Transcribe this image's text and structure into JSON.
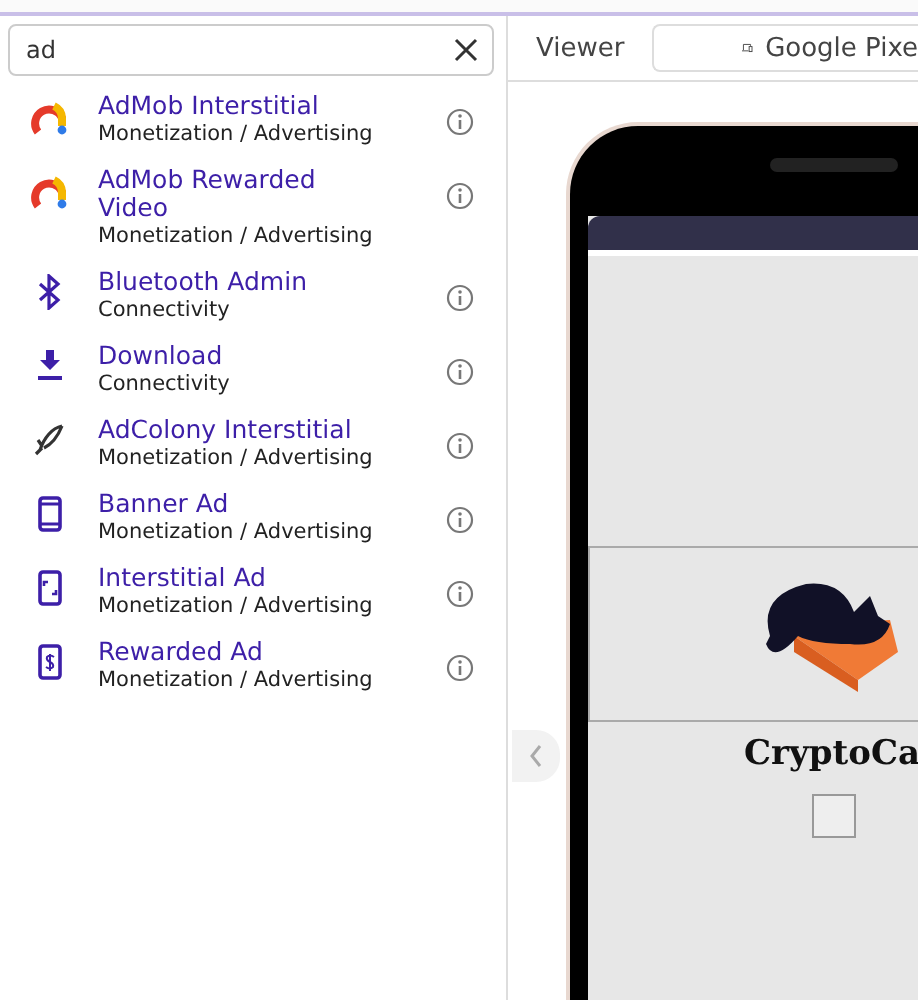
{
  "search": {
    "value": "ad"
  },
  "components": [
    {
      "name": "AdMob Interstitial",
      "category": "Monetization / Advertising",
      "kind": "admob"
    },
    {
      "name": "AdMob Rewarded Video",
      "category": "Monetization / Advertising",
      "kind": "admob"
    },
    {
      "name": "Bluetooth Admin",
      "category": "Connectivity",
      "kind": "bluetooth"
    },
    {
      "name": "Download",
      "category": "Connectivity",
      "kind": "download"
    },
    {
      "name": "AdColony Interstitial",
      "category": "Monetization / Advertising",
      "kind": "adcolony"
    },
    {
      "name": "Banner Ad",
      "category": "Monetization / Advertising",
      "kind": "banner"
    },
    {
      "name": "Interstitial Ad",
      "category": "Monetization / Advertising",
      "kind": "interstitial"
    },
    {
      "name": "Rewarded Ad",
      "category": "Monetization / Advertising",
      "kind": "rewarded"
    }
  ],
  "viewer": {
    "label": "Viewer",
    "device": "Google Pixe",
    "app_title": "CryptoCa",
    "checkbox_checked": false
  }
}
